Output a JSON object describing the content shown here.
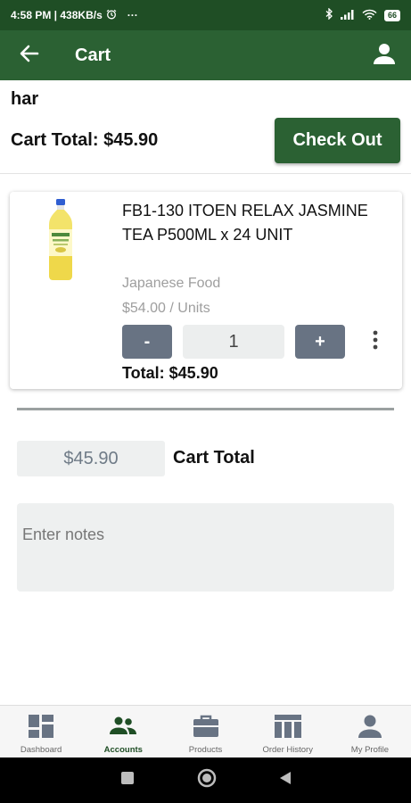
{
  "status_bar": {
    "left_text": "4:58 PM | 438KB/s",
    "alarm_icon": "alarm-icon",
    "overflow": "···",
    "battery": "66"
  },
  "app_bar": {
    "title": "Cart",
    "back_icon": "arrow-left-icon",
    "profile_icon": "person-icon"
  },
  "customer_name": "har",
  "cart_total_text": "Cart Total: $45.90",
  "checkout_label": "Check Out",
  "item": {
    "name": "FB1-130 ITOEN RELAX JASMINE TEA P500ML x 24 UNIT",
    "category": "Japanese Food",
    "price": "$54.00 / Units",
    "minus_label": "-",
    "plus_label": "+",
    "quantity": "1",
    "total_text": "Total: $45.90"
  },
  "summary": {
    "total_value": "$45.90",
    "total_label": "Cart Total"
  },
  "notes": {
    "placeholder": "Enter notes"
  },
  "bottom_nav": {
    "items": [
      {
        "label": "Dashboard",
        "icon": "dashboard-icon"
      },
      {
        "label": "Accounts",
        "icon": "people-icon",
        "active": true
      },
      {
        "label": "Products",
        "icon": "briefcase-icon"
      },
      {
        "label": "Order History",
        "icon": "table-icon"
      },
      {
        "label": "My Profile",
        "icon": "person-icon"
      }
    ]
  },
  "colors": {
    "status_bar": "#1f4e25",
    "app_bar": "#2b6133",
    "accent": "#2b6133",
    "qty_button": "#687383"
  }
}
